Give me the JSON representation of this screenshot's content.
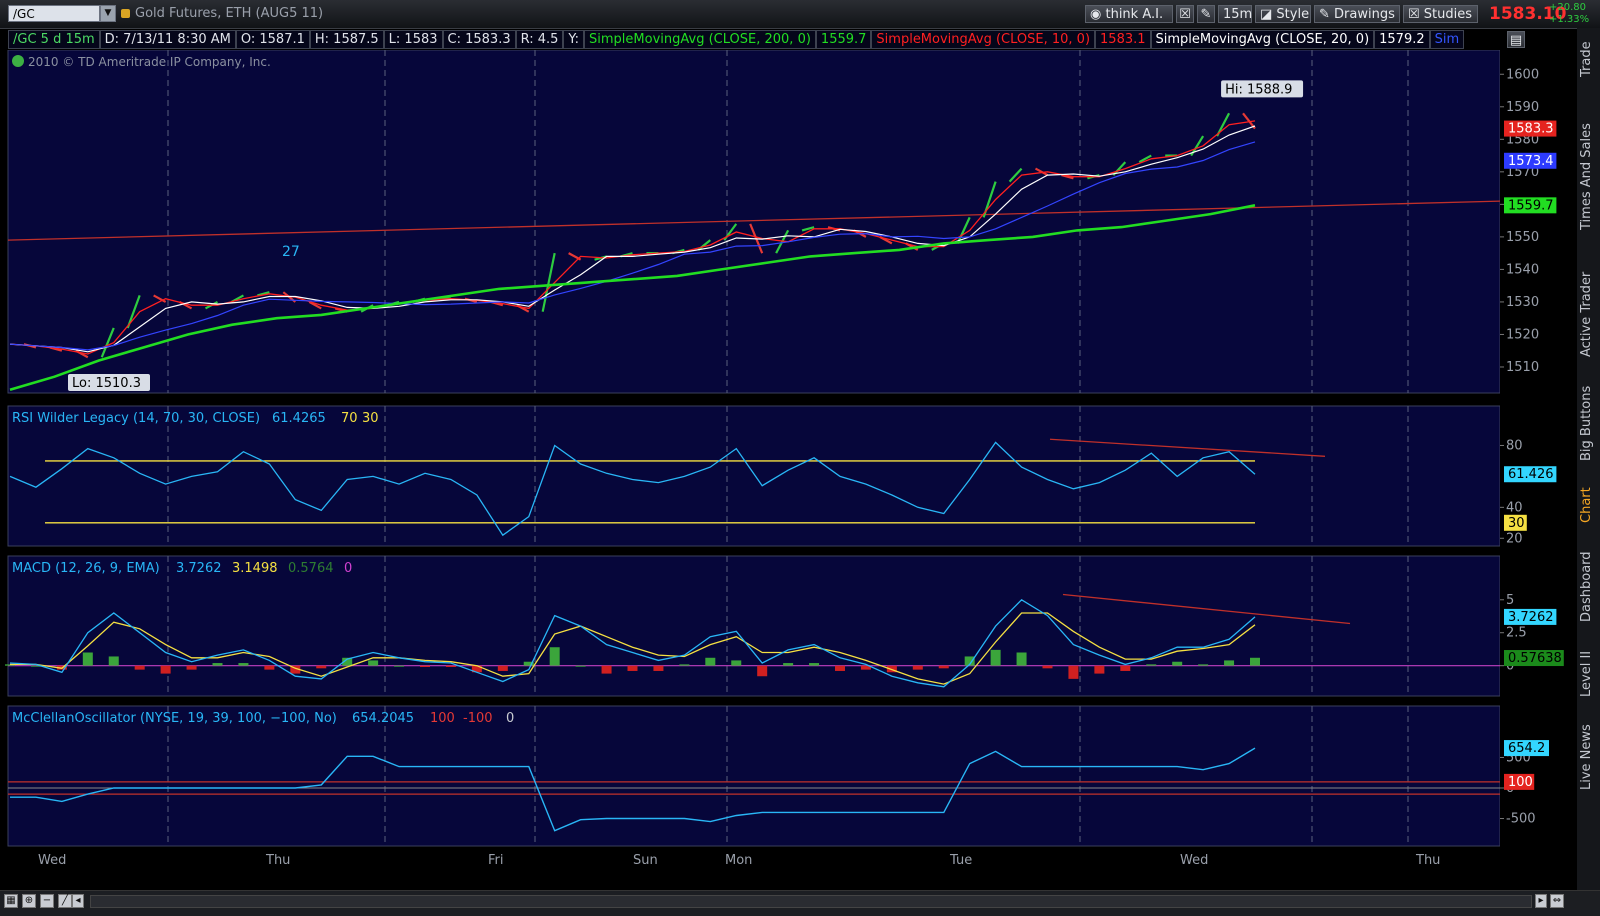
{
  "toolbar": {
    "symbol": "/GC",
    "instrument_title": "Gold Futures, ETH (AUG5 11)",
    "think_label": "think A.I.",
    "aggregation_label": "15m",
    "style_label": "Style",
    "drawings_label": "Drawings",
    "studies_label": "Studies",
    "last_price": "1583.10",
    "change_abs": "+20.80",
    "change_pct": "+1.33%"
  },
  "info": {
    "symbol_period": "/GC 5 d 15m",
    "date": "D: 7/13/11 8:30 AM",
    "open": "O: 1587.1",
    "high": "H: 1587.5",
    "low": "L: 1583",
    "close": "C: 1583.3",
    "range": "R: 4.5",
    "y": "Y:",
    "sma200_name": "SimpleMovingAvg (CLOSE, 200, 0)",
    "sma200_val": "1559.7",
    "sma10_name": "SimpleMovingAvg (CLOSE, 10, 0)",
    "sma10_val": "1583.1",
    "sma20_name": "SimpleMovingAvg (CLOSE, 20, 0)",
    "sma20_val": "1579.2",
    "sim_cut": "Sim"
  },
  "copyright": "2010 © TD Ameritrade IP Company, Inc.",
  "side_tabs": [
    "Trade",
    "Times And Sales",
    "Active Trader",
    "Big Buttons",
    "Chart",
    "Dashboard",
    "Level II",
    "Live News"
  ],
  "colors": {
    "panel_bg": "#06063a",
    "price": "#4caf50",
    "sma200": "#22dd22",
    "sma10": "#ff2020",
    "sma20": "#ffffff",
    "sma50": "#3344ff",
    "rsi": "#29b6f6",
    "macd": "#29b6f6",
    "signal": "#f5e042",
    "level": "#f5e042",
    "trend": "#c0302a"
  },
  "chart_data": [
    {
      "type": "line",
      "panel": "price",
      "title": "Gold Futures, ETH (AUG5 11)",
      "x_labels": [
        "Wed",
        "Thu",
        "Fri",
        "Sun",
        "Mon",
        "Tue",
        "Wed",
        "Thu"
      ],
      "ylim": [
        1502,
        1605
      ],
      "y_ticks": [
        1600,
        1590,
        1580,
        1570,
        1560,
        1550,
        1540,
        1530,
        1520,
        1510
      ],
      "hi_label": "Hi: 1588.9",
      "lo_label": "Lo: 1510.3",
      "annotation": "27",
      "price_tags": {
        "last": "1583.3",
        "sma50": "1573.4",
        "sma200": "1559.7"
      },
      "series": [
        {
          "name": "Close",
          "values": [
            1517,
            1516,
            1515,
            1513,
            1522,
            1532,
            1530,
            1528,
            1530,
            1532,
            1533,
            1530,
            1528,
            1527,
            1529,
            1530,
            1531,
            1531,
            1530,
            1529,
            1527,
            1545,
            1543,
            1544,
            1545,
            1545,
            1546,
            1549,
            1554,
            1545,
            1552,
            1553,
            1552,
            1550,
            1548,
            1546,
            1548,
            1556,
            1567,
            1571,
            1569,
            1568,
            1569,
            1573,
            1575,
            1575,
            1581,
            1588,
            1583.3
          ]
        },
        {
          "name": "SimpleMovingAvg (CLOSE, 200, 0)",
          "values": [
            1503,
            1507,
            1512,
            1516,
            1520,
            1523,
            1525,
            1526,
            1528,
            1530,
            1532,
            1534,
            1535,
            1536,
            1537,
            1538,
            1540,
            1542,
            1544,
            1545,
            1546,
            1548,
            1549,
            1550,
            1552,
            1553,
            1555,
            1557,
            1559.7
          ]
        }
      ],
      "trendline": [
        1549,
        1561
      ]
    },
    {
      "type": "line",
      "panel": "rsi",
      "title": "RSI Wilder Legacy (14, 70, 30, CLOSE)",
      "value_label": "61.4265",
      "overbought": "70",
      "oversold": "30",
      "ylim": [
        15,
        90
      ],
      "y_ticks": [
        80,
        40,
        20
      ],
      "price_tags": {
        "rsi": "61.426",
        "oversold": "30"
      },
      "series": [
        {
          "name": "RSI",
          "values": [
            60,
            53,
            65,
            78,
            72,
            62,
            55,
            60,
            63,
            76,
            68,
            45,
            38,
            58,
            60,
            55,
            62,
            58,
            48,
            22,
            34,
            80,
            68,
            62,
            58,
            56,
            60,
            66,
            78,
            54,
            64,
            72,
            60,
            55,
            48,
            40,
            36,
            58,
            82,
            66,
            58,
            52,
            56,
            64,
            75,
            60,
            72,
            76,
            61.4
          ]
        }
      ],
      "trendline": [
        84,
        73
      ]
    },
    {
      "type": "line",
      "panel": "macd",
      "title": "MACD (12, 26, 9, EMA)",
      "value_label": "3.7262",
      "avg_label": "3.1498",
      "diff_label": "0.5764",
      "zero_label": "0",
      "ylim": [
        -2.3,
        6.5
      ],
      "y_ticks": [
        5,
        2.5,
        0
      ],
      "price_tags": {
        "macd": "3.7262",
        "diff": "0.57638"
      },
      "series": [
        {
          "name": "MACD",
          "values": [
            0.2,
            0.1,
            -0.5,
            2.5,
            4.0,
            2.5,
            1.0,
            0.3,
            0.8,
            1.2,
            0.4,
            -0.8,
            -1.0,
            0.5,
            1.0,
            0.6,
            0.3,
            0.2,
            -0.5,
            -1.2,
            -0.3,
            3.8,
            3.0,
            1.6,
            1.0,
            0.4,
            0.8,
            2.2,
            2.6,
            0.2,
            1.2,
            1.6,
            0.6,
            0.1,
            -0.8,
            -1.3,
            -1.6,
            0.1,
            3.0,
            5.0,
            3.8,
            1.6,
            0.8,
            0.1,
            0.6,
            1.4,
            1.4,
            2.0,
            3.7
          ]
        },
        {
          "name": "Avg",
          "values": [
            0.1,
            0.1,
            -0.2,
            1.5,
            3.3,
            2.8,
            1.6,
            0.6,
            0.6,
            1.0,
            0.7,
            -0.2,
            -0.8,
            -0.1,
            0.6,
            0.6,
            0.4,
            0.3,
            0,
            -0.8,
            -0.6,
            2.4,
            3.0,
            2.2,
            1.4,
            0.8,
            0.7,
            1.6,
            2.2,
            1.0,
            1.0,
            1.4,
            1.0,
            0.4,
            -0.3,
            -1.0,
            -1.4,
            -0.6,
            1.8,
            4.0,
            4.0,
            2.6,
            1.4,
            0.5,
            0.5,
            1.1,
            1.3,
            1.6,
            3.1
          ]
        },
        {
          "name": "Diff",
          "values": [
            0.1,
            0,
            -0.3,
            1.0,
            0.7,
            -0.3,
            -0.6,
            -0.3,
            0.2,
            0.2,
            -0.3,
            -0.6,
            -0.2,
            0.6,
            0.4,
            0,
            -0.1,
            -0.1,
            -0.5,
            -0.4,
            0.3,
            1.4,
            0,
            -0.6,
            -0.4,
            -0.4,
            0.1,
            0.6,
            0.4,
            -0.8,
            0.2,
            0.2,
            -0.4,
            -0.3,
            -0.5,
            -0.3,
            -0.2,
            0.7,
            1.2,
            1.0,
            -0.2,
            -1.0,
            -0.6,
            -0.4,
            0.1,
            0.3,
            0.1,
            0.4,
            0.6
          ]
        }
      ],
      "trendline": [
        5.4,
        3.2
      ]
    },
    {
      "type": "line",
      "panel": "mcclellan",
      "title": "McClellanOscillator (NYSE, 19, 39, 100, −100, No)",
      "value_label": "654.2045",
      "upper_label": "100",
      "lower_label": "-100",
      "zero_label": "0",
      "ylim": [
        -950,
        950
      ],
      "y_ticks": [
        500,
        0,
        -500
      ],
      "price_tags": {
        "osc": "654.2",
        "level": "100"
      },
      "series": [
        {
          "name": "McClellan",
          "values": [
            -150,
            -150,
            -220,
            -100,
            0,
            0,
            0,
            0,
            0,
            0,
            0,
            0,
            50,
            520,
            520,
            350,
            350,
            350,
            350,
            350,
            350,
            -700,
            -520,
            -500,
            -500,
            -500,
            -500,
            -550,
            -450,
            -400,
            -400,
            -400,
            -400,
            -400,
            -400,
            -400,
            -400,
            400,
            600,
            350,
            350,
            350,
            350,
            350,
            350,
            350,
            300,
            400,
            654
          ]
        }
      ]
    }
  ]
}
